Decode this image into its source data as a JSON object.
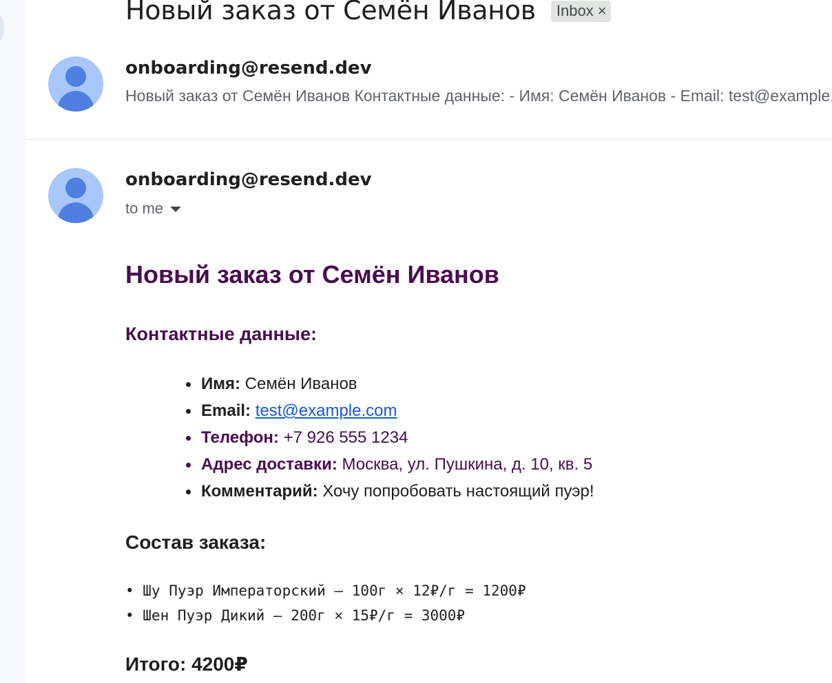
{
  "header": {
    "subject": "Новый заказ от Семён Иванов",
    "label_chip": "Inbox",
    "label_chip_close": "×"
  },
  "thread": {
    "collapsed": {
      "sender": "onboarding@resend.dev",
      "snippet": "Новый заказ от Семён Иванов Контактные данные: - Имя: Семён Иванов - Email: test@example.com"
    },
    "expanded": {
      "sender": "onboarding@resend.dev",
      "recipient": "to me"
    }
  },
  "email_body": {
    "title": "Новый заказ от Семён Иванов",
    "contacts_heading": "Контактные данные:",
    "contacts": [
      {
        "label": "Имя:",
        "value": "Семён Иванов"
      },
      {
        "label": "Email:",
        "value": "test@example.com"
      },
      {
        "label": "Телефон:",
        "value": "+7 926 555 1234"
      },
      {
        "label": "Адрес доставки:",
        "value": "Москва, ул. Пушкина, д. 10, кв. 5"
      },
      {
        "label": "Комментарий:",
        "value": "Хочу попробовать настоящий пуэр!"
      }
    ],
    "order_heading": "Состав заказа:",
    "order_lines": [
      "• Шу Пуэр Императорский — 100г × 12₽/г = 1200₽",
      "• Шен Пуэр Дикий — 200г × 15₽/г = 3000₽"
    ],
    "total": "Итого: 4200₽"
  },
  "colors": {
    "accent_purple": "#4a0c50",
    "link_blue": "#1a57d6",
    "avatar_bg": "#a8c7fa",
    "avatar_fg": "#4f7fe0",
    "chip_bg": "#e1e3e1"
  },
  "icons": {
    "avatar": "person-avatar-icon",
    "chip_close": "close-icon",
    "recipient_dropdown": "caret-down-icon"
  }
}
